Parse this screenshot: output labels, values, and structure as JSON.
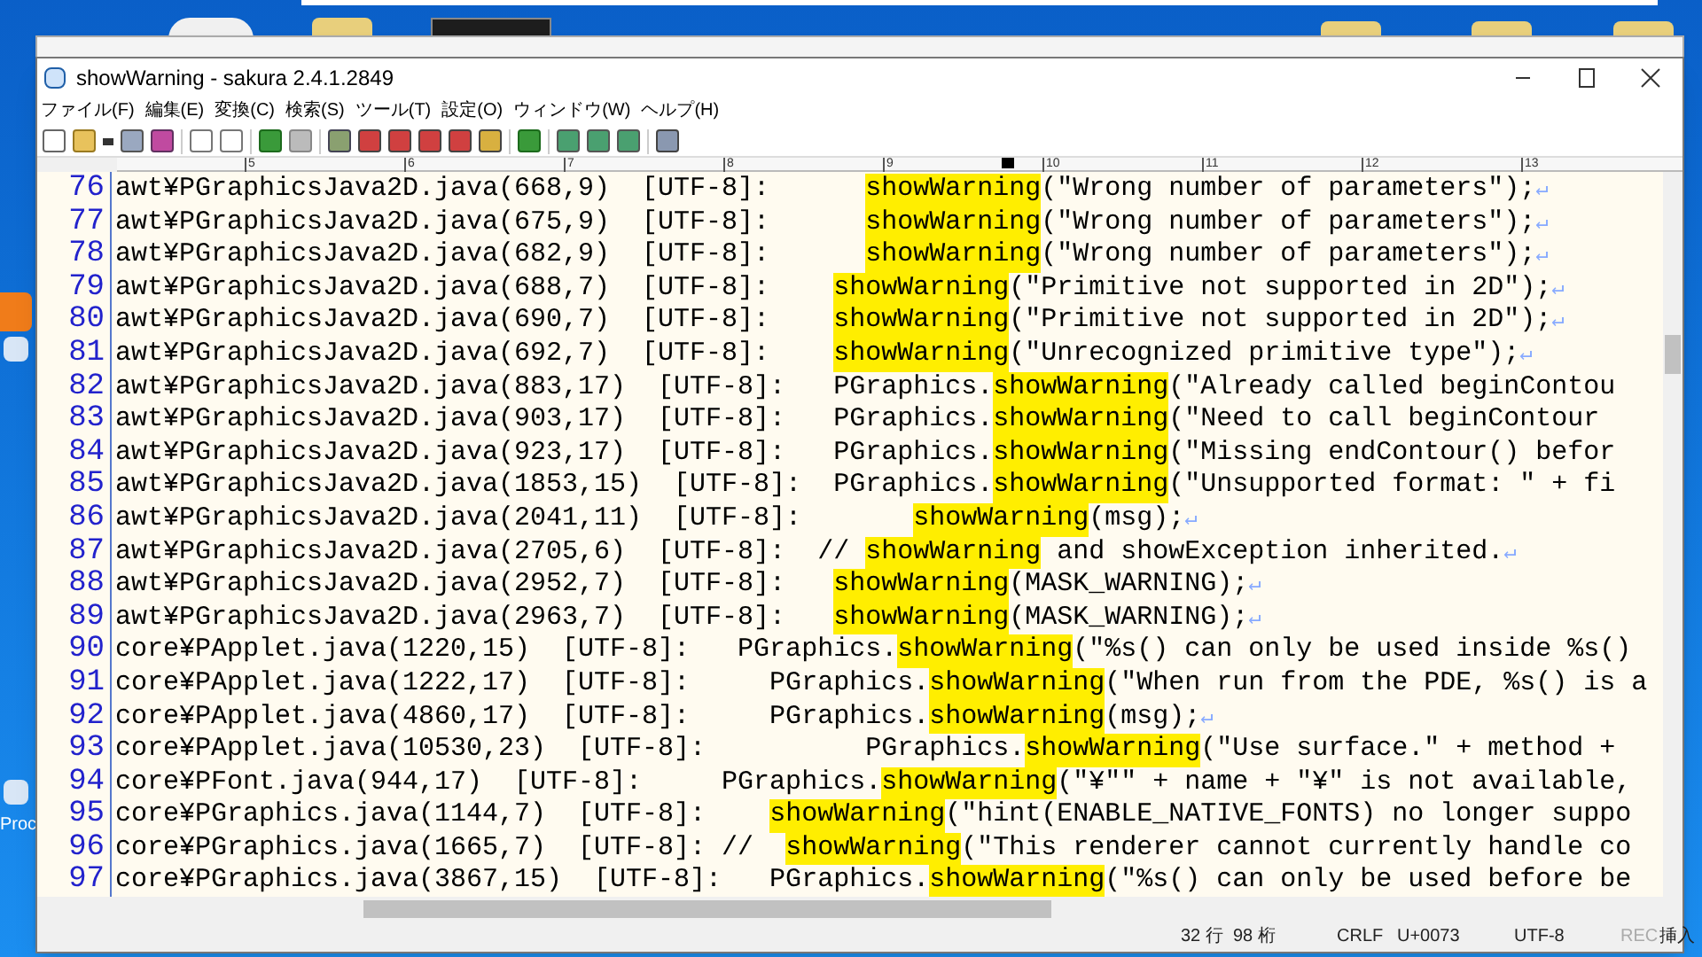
{
  "desktop": {
    "label": "Proc"
  },
  "window": {
    "title": "showWarning - sakura 2.4.1.2849"
  },
  "menu": [
    "ファイル(F)",
    "編集(E)",
    "変換(C)",
    "検索(S)",
    "ツール(T)",
    "設定(O)",
    "ウィンドウ(W)",
    "ヘルプ(H)"
  ],
  "ruler": {
    "labels": [
      "5",
      "6",
      "7",
      "8",
      "9",
      "10",
      "11",
      "12",
      "13"
    ]
  },
  "lines": [
    {
      "number": "76",
      "before": "awt¥PGraphicsJava2D.java(668,9)  [UTF-8]:      ",
      "match": "showWarning",
      "after": "(\"Wrong number of parameters\");",
      "eol": true
    },
    {
      "number": "77",
      "before": "awt¥PGraphicsJava2D.java(675,9)  [UTF-8]:      ",
      "match": "showWarning",
      "after": "(\"Wrong number of parameters\");",
      "eol": true
    },
    {
      "number": "78",
      "before": "awt¥PGraphicsJava2D.java(682,9)  [UTF-8]:      ",
      "match": "showWarning",
      "after": "(\"Wrong number of parameters\");",
      "eol": true
    },
    {
      "number": "79",
      "before": "awt¥PGraphicsJava2D.java(688,7)  [UTF-8]:    ",
      "match": "showWarning",
      "after": "(\"Primitive not supported in 2D\");",
      "eol": true
    },
    {
      "number": "80",
      "before": "awt¥PGraphicsJava2D.java(690,7)  [UTF-8]:    ",
      "match": "showWarning",
      "after": "(\"Primitive not supported in 2D\");",
      "eol": true
    },
    {
      "number": "81",
      "before": "awt¥PGraphicsJava2D.java(692,7)  [UTF-8]:    ",
      "match": "showWarning",
      "after": "(\"Unrecognized primitive type\");",
      "eol": true
    },
    {
      "number": "82",
      "before": "awt¥PGraphicsJava2D.java(883,17)  [UTF-8]:   PGraphics.",
      "match": "showWarning",
      "after": "(\"Already called beginContou",
      "eol": false
    },
    {
      "number": "83",
      "before": "awt¥PGraphicsJava2D.java(903,17)  [UTF-8]:   PGraphics.",
      "match": "showWarning",
      "after": "(\"Need to call beginContour",
      "eol": false
    },
    {
      "number": "84",
      "before": "awt¥PGraphicsJava2D.java(923,17)  [UTF-8]:   PGraphics.",
      "match": "showWarning",
      "after": "(\"Missing endContour() befor",
      "eol": false
    },
    {
      "number": "85",
      "before": "awt¥PGraphicsJava2D.java(1853,15)  [UTF-8]:  PGraphics.",
      "match": "showWarning",
      "after": "(\"Unsupported format: \" + fi",
      "eol": false
    },
    {
      "number": "86",
      "before": "awt¥PGraphicsJava2D.java(2041,11)  [UTF-8]:       ",
      "match": "showWarning",
      "after": "(msg);",
      "eol": true
    },
    {
      "number": "87",
      "before": "awt¥PGraphicsJava2D.java(2705,6)  [UTF-8]:  // ",
      "match": "showWarning",
      "after": " and showException inherited.",
      "eol": true
    },
    {
      "number": "88",
      "before": "awt¥PGraphicsJava2D.java(2952,7)  [UTF-8]:   ",
      "match": "showWarning",
      "after": "(MASK_WARNING);",
      "eol": true
    },
    {
      "number": "89",
      "before": "awt¥PGraphicsJava2D.java(2963,7)  [UTF-8]:   ",
      "match": "showWarning",
      "after": "(MASK_WARNING);",
      "eol": true
    },
    {
      "number": "90",
      "before": "core¥PApplet.java(1220,15)  [UTF-8]:   PGraphics.",
      "match": "showWarning",
      "after": "(\"%s() can only be used inside %s()",
      "eol": false
    },
    {
      "number": "91",
      "before": "core¥PApplet.java(1222,17)  [UTF-8]:     PGraphics.",
      "match": "showWarning",
      "after": "(\"When run from the PDE, %s() is a",
      "eol": false
    },
    {
      "number": "92",
      "before": "core¥PApplet.java(4860,17)  [UTF-8]:     PGraphics.",
      "match": "showWarning",
      "after": "(msg);",
      "eol": true
    },
    {
      "number": "93",
      "before": "core¥PApplet.java(10530,23)  [UTF-8]:          PGraphics.",
      "match": "showWarning",
      "after": "(\"Use surface.\" + method +",
      "eol": false
    },
    {
      "number": "94",
      "before": "core¥PFont.java(944,17)  [UTF-8]:     PGraphics.",
      "match": "showWarning",
      "after": "(\"¥\"\" + name + \"¥\" is not available,",
      "eol": false
    },
    {
      "number": "95",
      "before": "core¥PGraphics.java(1144,7)  [UTF-8]:    ",
      "match": "showWarning",
      "after": "(\"hint(ENABLE_NATIVE_FONTS) no longer suppo",
      "eol": false
    },
    {
      "number": "96",
      "before": "core¥PGraphics.java(1665,7)  [UTF-8]: //  ",
      "match": "showWarning",
      "after": "(\"This renderer cannot currently handle co",
      "eol": false
    },
    {
      "number": "97",
      "before": "core¥PGraphics.java(3867,15)  [UTF-8]:   PGraphics.",
      "match": "showWarning",
      "after": "(\"%s() can only be used before be",
      "eol": false
    }
  ],
  "eol_mark": "↵",
  "status_bar": {
    "position": "32 行  98 桁",
    "line_ending": "CRLF",
    "code_point": "U+0073",
    "encoding": "UTF-8",
    "rec": "REC",
    "mode": "挿入"
  }
}
